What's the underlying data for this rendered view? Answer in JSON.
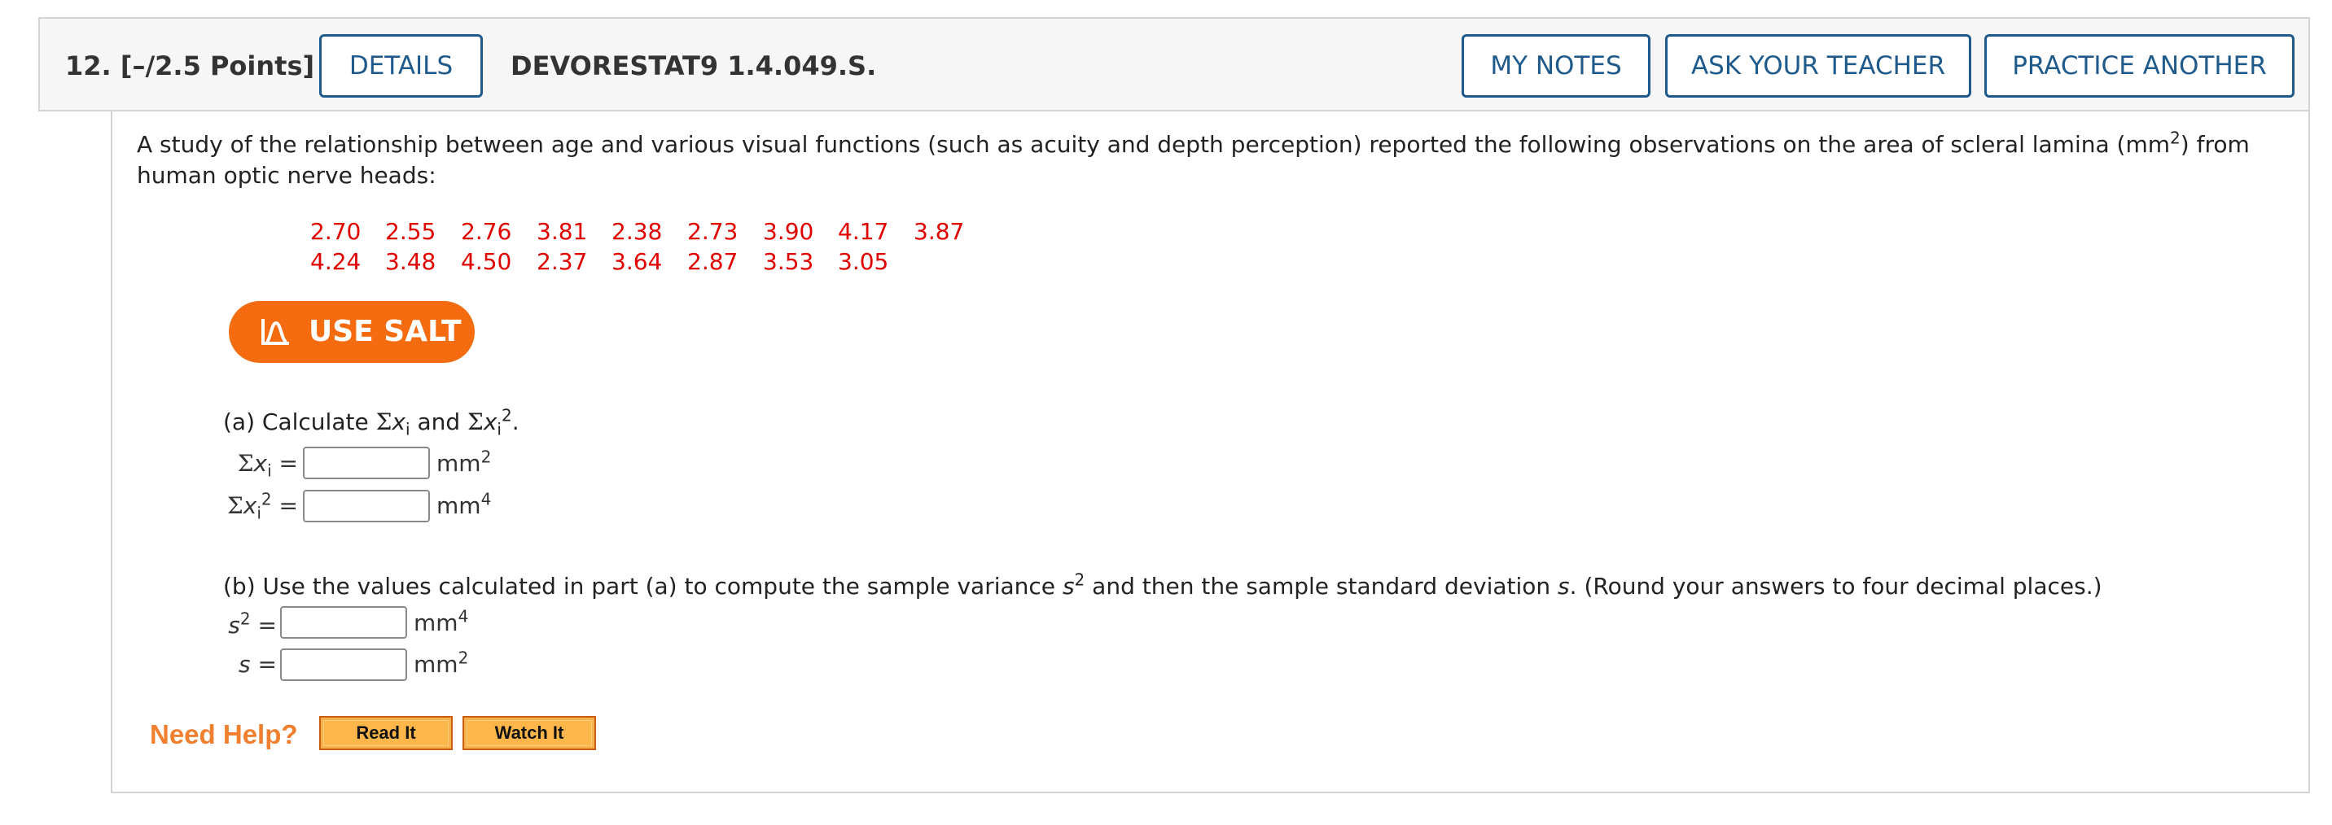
{
  "question": {
    "number_points": "12.  [–/2.5 Points]",
    "details_button": "DETAILS",
    "code": "DEVORESTAT9 1.4.049.S.",
    "my_notes_button": "MY NOTES",
    "ask_teacher_button": "ASK YOUR TEACHER",
    "practice_another_button": "PRACTICE ANOTHER"
  },
  "intro": {
    "text_before": "A study of the relationship between age and various visual functions (such as acuity and depth perception) reported the following observations on the area of scleral lamina (mm",
    "sup": "2",
    "text_after": ") from human optic nerve heads:"
  },
  "data_rows": [
    [
      "2.70",
      "2.55",
      "2.76",
      "3.81",
      "2.38",
      "2.73",
      "3.90",
      "4.17",
      "3.87"
    ],
    [
      "4.24",
      "3.48",
      "4.50",
      "2.37",
      "3.64",
      "2.87",
      "3.53",
      "3.05"
    ]
  ],
  "salt_button": "USE SALT",
  "part_a": {
    "prompt": "(a) Calculate",
    "sigma": "Σ",
    "x": "x",
    "i": "i",
    "and": "and",
    "two": "2",
    "period": ".",
    "eq": "=",
    "field1_value": "",
    "field2_value": "",
    "unit_base": "mm",
    "unit1_exp": "2",
    "unit2_exp": "4"
  },
  "part_b": {
    "text_before": "(b) Use the values calculated in part (a) to compute the sample variance",
    "s": "s",
    "two": "2",
    "text_middle": "and then the sample standard deviation",
    "text_after": ". (Round your answers to four decimal places.)",
    "eq": "=",
    "field1_value": "",
    "field2_value": "",
    "unit_base": "mm",
    "unit1_exp": "4",
    "unit2_exp": "2"
  },
  "help": {
    "label": "Need Help?",
    "read_it": "Read It",
    "watch_it": "Watch It"
  },
  "colors": {
    "link_blue": "#1f5a8c",
    "data_red": "#e00000",
    "salt_orange": "#f56b10",
    "help_orange": "#f08030"
  },
  "icons": {
    "salt": "bell-curve-icon"
  }
}
